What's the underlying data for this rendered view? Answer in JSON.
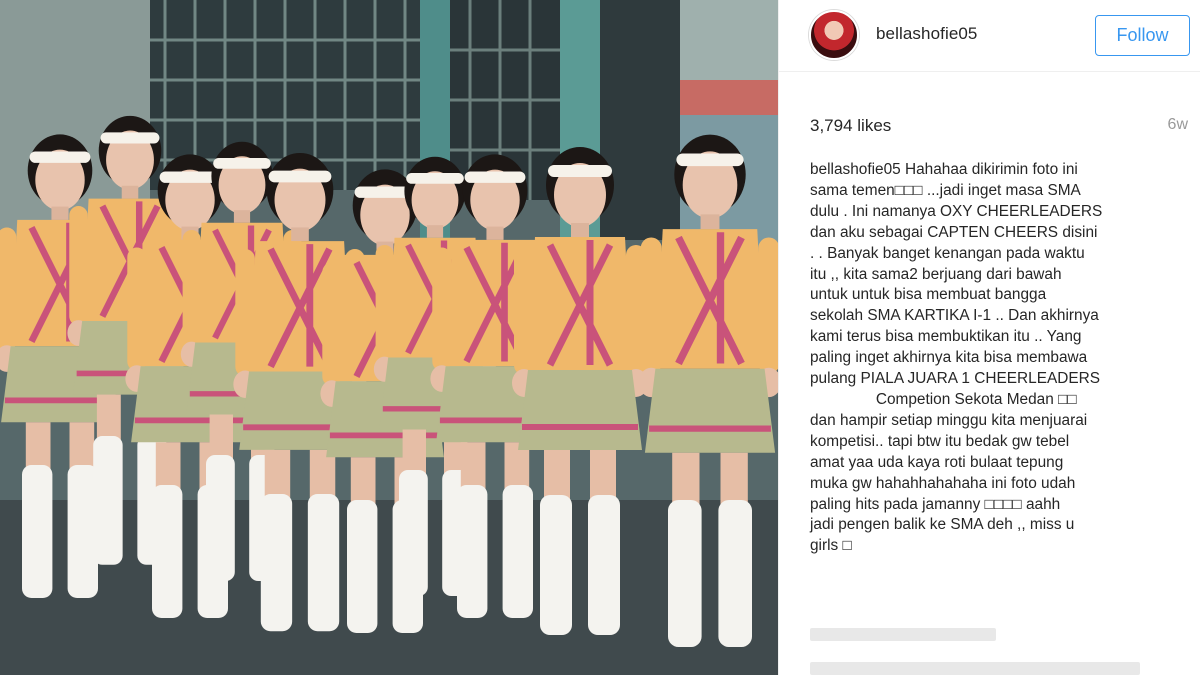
{
  "post": {
    "username": "bellashofie05",
    "follow_label": "Follow",
    "likes": "3,794 likes",
    "age": "6w",
    "caption_user": "bellashofie05",
    "caption_text": "Hahahaa dikirimin foto ini\nsama temen□□□ ...jadi inget masa SMA\ndulu . Ini namanya OXY CHEERLEADERS\ndan aku sebagai CAPTEN CHEERS disini\n. . Banyak banget kenangan pada waktu\nitu ,, kita sama2 berjuang dari bawah\nuntuk untuk bisa membuat bangga\nsekolah SMA KARTIKA I-1 .. Dan akhirnya\nkami terus bisa membuktikan itu .. Yang\npaling inget akhirnya kita bisa membawa\npulang PIALA JUARA 1 CHEERLEADERS\n     Competion Sekota Medan □□\ndan hampir setiap minggu kita menjuarai\nkompetisi.. tapi btw itu bedak gw tebel\namat yaa uda kaya roti bulaat tepung\nmuka gw hahahhahahaha ini foto udah\npaling hits pada jamanny □□□□ aahh\njadi pengen balik ke SMA deh ,, miss u\ngirls □"
  },
  "colors": {
    "link_blue": "#3897f0",
    "text": "#262626",
    "muted": "#999999",
    "uniform_yellow": "#f0b86a",
    "uniform_pink": "#c9537a",
    "skirt_green": "#b7b98e"
  },
  "icons": {
    "avatar": "profile-photo"
  }
}
